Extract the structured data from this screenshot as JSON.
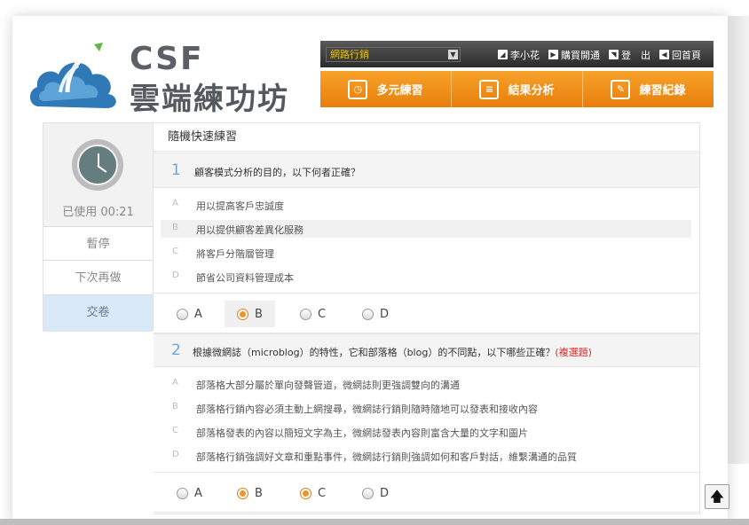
{
  "logo": {
    "csf": "CSF",
    "subtitle": "雲端練功坊"
  },
  "topbar": {
    "course": "網路行銷",
    "nav": [
      {
        "label": "李小花",
        "icon": "user-icon"
      },
      {
        "label": "購買開通",
        "icon": "cart-icon"
      },
      {
        "label": "登　出",
        "icon": "logout-icon"
      },
      {
        "label": "回首頁",
        "icon": "home-icon"
      }
    ]
  },
  "menu": [
    {
      "label": "多元練習",
      "icon": "clock-calendar-icon"
    },
    {
      "label": "結果分析",
      "icon": "document-icon"
    },
    {
      "label": "練習紀錄",
      "icon": "edit-icon"
    }
  ],
  "sidebar": {
    "used_label": "已使用 00:21",
    "pause": "暫停",
    "later": "下次再做",
    "submit": "交卷"
  },
  "section_title": "隨機快速練習",
  "questions": [
    {
      "number": "1",
      "text": "顧客模式分析的目的，以下何者正確？",
      "multi_tag": "",
      "options": [
        {
          "letter": "A",
          "text": "用以提高客戶忠誠度"
        },
        {
          "letter": "B",
          "text": "用以提供顧客差異化服務"
        },
        {
          "letter": "C",
          "text": "將客戶分階層管理"
        },
        {
          "letter": "D",
          "text": "節省公司資料管理成本"
        }
      ],
      "answers": [
        "A",
        "B",
        "C",
        "D"
      ],
      "selected": [
        "B"
      ]
    },
    {
      "number": "2",
      "text": "根據微網誌（microblog）的特性，它和部落格（blog）的不同點，以下哪些正確？",
      "multi_tag": "(複選題)",
      "options": [
        {
          "letter": "A",
          "text": "部落格大部分屬於單向發聲管道，微網誌則更強調雙向的溝通"
        },
        {
          "letter": "B",
          "text": "部落格行銷內容必須主動上網搜尋，微網誌行銷則隨時隨地可以發表和接收內容"
        },
        {
          "letter": "C",
          "text": "部落格發表的內容以簡短文字為主，微網誌發表內容則富含大量的文字和圖片"
        },
        {
          "letter": "D",
          "text": "部落格行銷強調好文章和重點事件，微網誌行銷則強調如何和客戶對話，維繫溝通的品質"
        }
      ],
      "answers": [
        "A",
        "B",
        "C",
        "D"
      ],
      "selected": [
        "B",
        "C"
      ]
    }
  ],
  "colors": {
    "accent_orange": "#f0932b",
    "question_number": "#6fa7d7",
    "multi_tag": "#d42b2b",
    "submit_bg": "#d9e9f8"
  }
}
